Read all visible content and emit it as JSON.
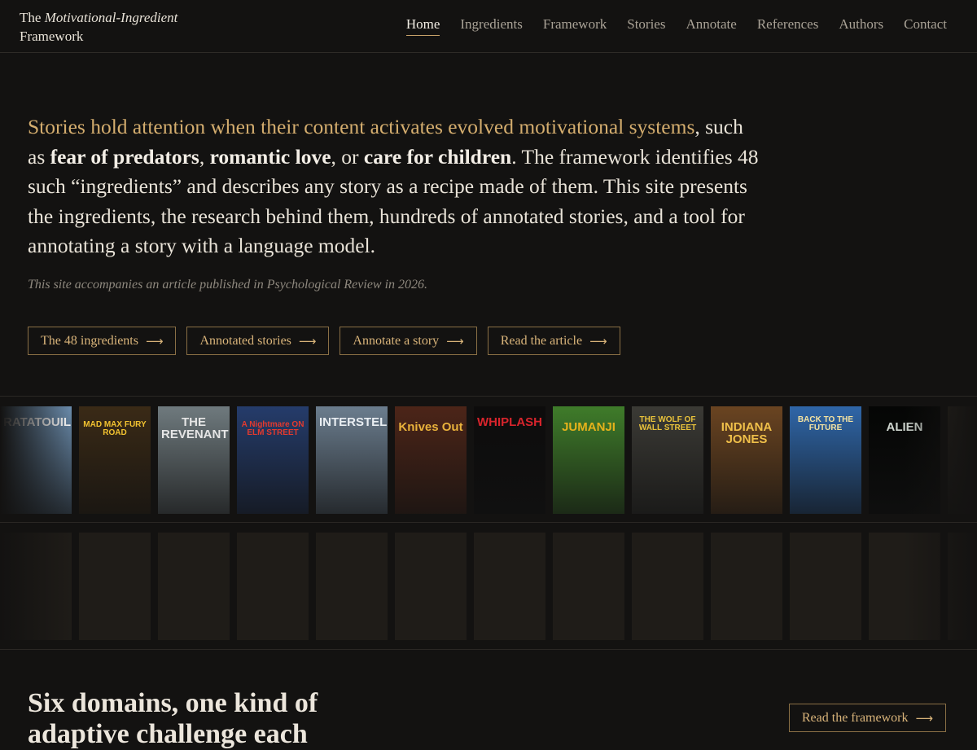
{
  "brand": {
    "prefix": "The",
    "italic": "Motivational-Ingredient",
    "suffix": "Framework"
  },
  "nav": [
    {
      "label": "Home",
      "active": true
    },
    {
      "label": "Ingredients",
      "active": false
    },
    {
      "label": "Framework",
      "active": false
    },
    {
      "label": "Stories",
      "active": false
    },
    {
      "label": "Annotate",
      "active": false
    },
    {
      "label": "References",
      "active": false
    },
    {
      "label": "Authors",
      "active": false
    },
    {
      "label": "Contact",
      "active": false
    }
  ],
  "hero": {
    "lead": "Stories hold attention when their content activates evolved motivational systems",
    "t1": ", such as ",
    "b1": "fear of predators",
    "t2": ", ",
    "b2": "romantic love",
    "t3": ", or ",
    "b3": "care for children",
    "t4": ". The framework identifies 48 such “ingredients” and describes any story as a recipe made of them. This site presents the ingredients, the research behind them, hundreds of annotated stories, and a tool for annotating a story with a language model."
  },
  "note": "This site accompanies an article published in Psychological Review in 2026.",
  "ctas": [
    {
      "label": "The 48 ingredients",
      "icon": "arrow-right-icon"
    },
    {
      "label": "Annotated stories",
      "icon": "arrow-right-icon"
    },
    {
      "label": "Annotate a story",
      "icon": "arrow-right-icon"
    },
    {
      "label": "Read the article",
      "icon": "arrow-right-icon"
    }
  ],
  "posters": [
    {
      "title": "RATATOUILLE",
      "bg": "#6d8fb0",
      "fg": "#ffffff"
    },
    {
      "title": "MAD MAX FURY ROAD",
      "bg": "#3a2a16",
      "fg": "#f2c230"
    },
    {
      "title": "THE REVENANT",
      "bg": "#6f7a7e",
      "fg": "#e5e5e5"
    },
    {
      "title": "A Nightmare ON ELM STREET",
      "bg": "#253c6b",
      "fg": "#e43a2e"
    },
    {
      "title": "INTERSTELLAR",
      "bg": "#6b7d8e",
      "fg": "#e9eef2"
    },
    {
      "title": "Knives Out",
      "bg": "#4c2518",
      "fg": "#e9b23b"
    },
    {
      "title": "WHIPLASH",
      "bg": "#0d0c0c",
      "fg": "#d8242c"
    },
    {
      "title": "JUMANJI",
      "bg": "#3f7c2a",
      "fg": "#e6b21b"
    },
    {
      "title": "THE WOLF OF WALL STREET",
      "bg": "#3b3a35",
      "fg": "#e9c23b"
    },
    {
      "title": "INDIANA JONES",
      "bg": "#6a4421",
      "fg": "#f0c04a"
    },
    {
      "title": "BACK TO THE FUTURE",
      "bg": "#2f66a8",
      "fg": "#f4e3a2"
    },
    {
      "title": "ALIEN",
      "bg": "#050605",
      "fg": "#cfd6cf"
    },
    {
      "title": "",
      "bg": "#2a2620",
      "fg": "#cfcfcf"
    }
  ],
  "section": {
    "title": "Six domains, one kind of adaptive challenge each",
    "button": "Read the framework",
    "button_icon": "arrow-right-icon"
  }
}
